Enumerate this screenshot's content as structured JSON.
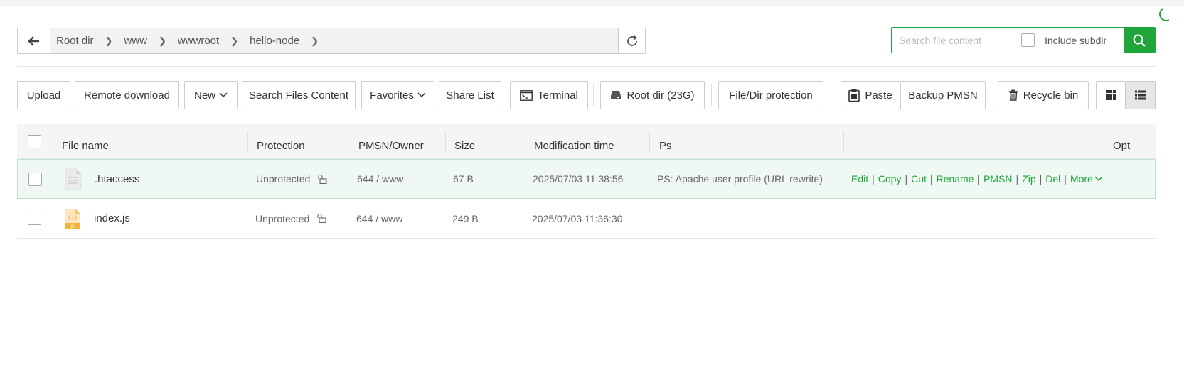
{
  "breadcrumb": {
    "items": [
      "Root dir",
      "www",
      "wwwroot",
      "hello-node"
    ]
  },
  "search": {
    "placeholder": "Search file content",
    "subdir_label": "Include subdir"
  },
  "toolbar": {
    "upload": "Upload",
    "remote_download": "Remote download",
    "new": "New",
    "search_files": "Search Files Content",
    "favorites": "Favorites",
    "share_list": "Share List",
    "terminal": "Terminal",
    "root_dir": "Root dir (23G)",
    "protection": "File/Dir protection",
    "paste": "Paste",
    "backup": "Backup PMSN",
    "recycle": "Recycle bin"
  },
  "table": {
    "headers": {
      "name": "File name",
      "protection": "Protection",
      "owner": "PMSN/Owner",
      "size": "Size",
      "mtime": "Modification time",
      "ps": "Ps",
      "opt": "Opt"
    },
    "rows": [
      {
        "name": ".htaccess",
        "icon": "text-file-icon",
        "protection": "Unprotected",
        "owner": "644 / www",
        "size": "67 B",
        "mtime": "2025/07/03 11:38:56",
        "ps": "PS: Apache user profile (URL rewrite)"
      },
      {
        "name": "index.js",
        "icon": "js-file-icon",
        "protection": "Unprotected",
        "owner": "644 / www",
        "size": "249 B",
        "mtime": "2025/07/03 11:36:30",
        "ps": ""
      }
    ],
    "ops": [
      "Edit",
      "Copy",
      "Cut",
      "Rename",
      "PMSN",
      "Zip",
      "Del",
      "More"
    ]
  },
  "colors": {
    "accent": "#20a53a"
  }
}
